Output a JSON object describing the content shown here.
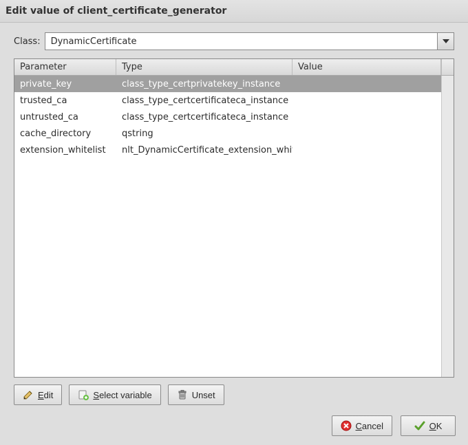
{
  "window": {
    "title": "Edit value of client_certificate_generator"
  },
  "class_selector": {
    "label": "Class:",
    "value": "DynamicCertificate"
  },
  "table": {
    "headers": {
      "parameter": "Parameter",
      "type": "Type",
      "value": "Value"
    },
    "rows": [
      {
        "parameter": "private_key",
        "type": "class_type_certprivatekey_instance",
        "value": "",
        "selected": true
      },
      {
        "parameter": "trusted_ca",
        "type": "class_type_certcertificateca_instance",
        "value": "",
        "selected": false
      },
      {
        "parameter": "untrusted_ca",
        "type": "class_type_certcertificateca_instance",
        "value": "",
        "selected": false
      },
      {
        "parameter": "cache_directory",
        "type": "qstring",
        "value": "",
        "selected": false
      },
      {
        "parameter": "extension_whitelist",
        "type": "nlt_DynamicCertificate_extension_whitelist",
        "value": "",
        "selected": false
      }
    ]
  },
  "actions": {
    "edit": "Edit",
    "select_variable": "Select variable",
    "unset": "Unset"
  },
  "footer": {
    "cancel": "Cancel",
    "ok": "OK"
  }
}
